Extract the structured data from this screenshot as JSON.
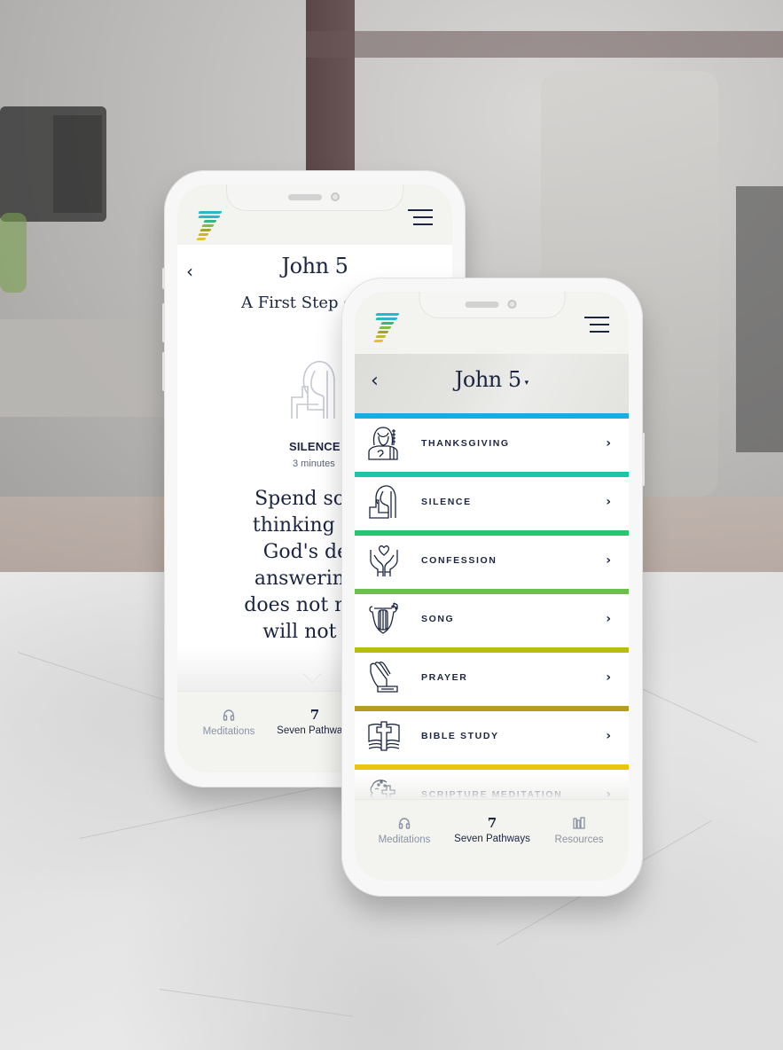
{
  "scene": {
    "description_icons": [
      "seven-logo-icon",
      "hamburger-menu-icon"
    ]
  },
  "back_phone": {
    "title": "John 5",
    "subtitle": "A First Step of",
    "back_arrow": "‹",
    "pathway": {
      "name": "SILENCE",
      "duration": "3 minutes",
      "icon": "silence-figure-icon"
    },
    "body_lines": [
      "Spend some",
      "thinking abo",
      "God's dela",
      "answering a",
      "does not mear",
      "will not an"
    ],
    "scroll_hint_icon": "chevron-down-icon",
    "tabs": [
      {
        "label": "Meditations",
        "icon": "headphones-icon",
        "glyph": "🎧",
        "active": false
      },
      {
        "label": "Seven Pathways",
        "icon": "seven-icon",
        "glyph": "7",
        "active": true
      }
    ]
  },
  "front_phone": {
    "chapter": {
      "title": "John 5",
      "caret": "▾",
      "back_arrow": "‹"
    },
    "pathways": [
      {
        "label": "THANKSGIVING",
        "color": "#14aee0",
        "icon": "thanksgiving-icon"
      },
      {
        "label": "SILENCE",
        "color": "#1cc5a5",
        "icon": "silence-icon"
      },
      {
        "label": "CONFESSION",
        "color": "#24c770",
        "icon": "confession-icon"
      },
      {
        "label": "SONG",
        "color": "#6cc04a",
        "icon": "song-lyre-icon"
      },
      {
        "label": "PRAYER",
        "color": "#b8bd0a",
        "icon": "prayer-hands-icon"
      },
      {
        "label": "BIBLE STUDY",
        "color": "#b59d23",
        "icon": "bible-study-icon"
      },
      {
        "label": "SCRIPTURE MEDITATION",
        "color": "#ecc40e",
        "icon": "scripture-meditation-icon"
      }
    ],
    "chevron": "›",
    "tabs": [
      {
        "label": "Meditations",
        "icon": "headphones-icon",
        "glyph": "🎧",
        "active": false
      },
      {
        "label": "Seven Pathways",
        "icon": "seven-icon",
        "glyph": "7",
        "active": true
      },
      {
        "label": "Resources",
        "icon": "books-icon",
        "glyph": "▥",
        "active": false
      }
    ]
  },
  "brand_colors": {
    "navy": "#1b2540",
    "header_bg": "#f3f3ef",
    "logo_stripes": [
      "#2bb6c9",
      "#2bb6c9",
      "#36b886",
      "#7dbd4a",
      "#a3a52a",
      "#c9b534",
      "#e4c22a"
    ]
  }
}
